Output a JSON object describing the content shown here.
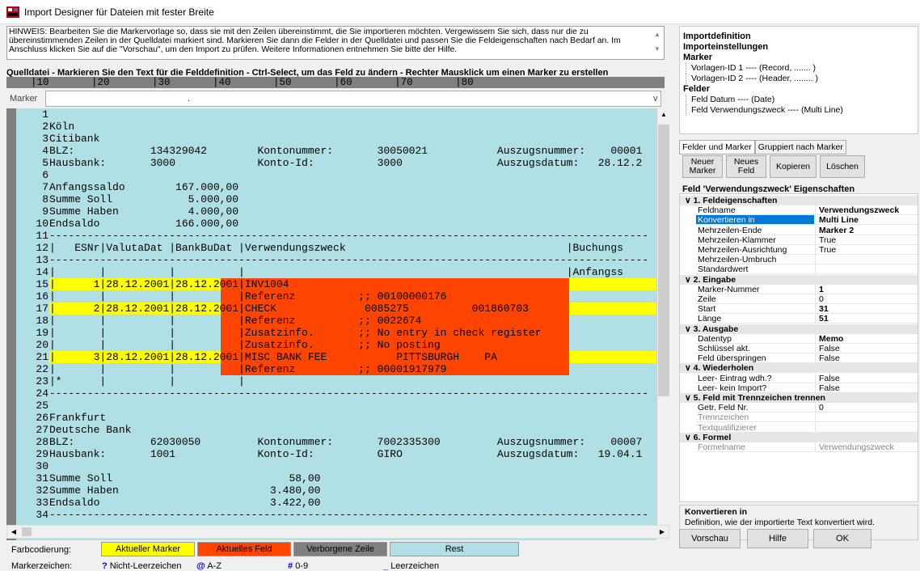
{
  "window": {
    "title": "Import Designer für Dateien mit fester Breite"
  },
  "hint": "HINWEIS: Bearbeiten Sie die Markervorlage so, dass sie mit den Zeilen übereinstimmt, die Sie importieren möchten. Vergewissem Sie sich, dass nur die zu übereinstimmenden Zeilen in der Quelldatei markiert sind. Markieren Sie dann die Felder in der Quelldatei und passen Sie die Feldeigenschaften nach Bedarf an. Im Anschluss klicken Sie auf die \"Vorschau\", um den Import zu prüfen. Weitere Informationen entnehmen Sie bitte der Hilfe.",
  "source_label": "Quelldatei - Markieren Sie den Text für die Felddefinition - Ctrl-Select, um das Feld zu ändern - Rechter Mausklick um einen Marker zu erstellen",
  "ruler": "    |10       |20       |30       |40       |50       |60       |70       |80",
  "marker": {
    "label": "Marker",
    "value": ".",
    "dropdown": "v"
  },
  "lines": [
    {
      "n": "1",
      "t": ""
    },
    {
      "n": "2",
      "t": "Köln"
    },
    {
      "n": "3",
      "t": "Citibank"
    },
    {
      "n": "4",
      "t": "BLZ:            134329042        Kontonummer:       30050021           Auszugsnummer:    00001"
    },
    {
      "n": "5",
      "t": "Hausbank:       3000             Konto-Id:          3000               Auszugsdatum:   28.12.2"
    },
    {
      "n": "6",
      "t": ""
    },
    {
      "n": "7",
      "t": "Anfangssaldo        167.000,00"
    },
    {
      "n": "8",
      "t": "Summe Soll            5.000,00"
    },
    {
      "n": "9",
      "t": "Summe Haben           4.000,00"
    },
    {
      "n": "10",
      "t": "Endsaldo            166.000,00"
    },
    {
      "n": "11",
      "t": "-----------------------------------------------------------------------------------------------"
    },
    {
      "n": "12",
      "t": "|   ESNr|ValutaDat |BankBuDat |Verwendungszweck                                   |Buchungs"
    },
    {
      "n": "13",
      "t": "-----------------------------------------------------------------------------------------------"
    },
    {
      "n": "14",
      "t": "|       |          |          |                                                   |Anfangss"
    },
    {
      "n": "15",
      "t": "|      1|28.12.2001|28.12.2001|INV1004"
    },
    {
      "n": "16",
      "t": "|       |          |          |Referenz          ;; 00100000176"
    },
    {
      "n": "17",
      "t": "|      2|28.12.2001|28.12.2001|CHECK              0085275          001860703"
    },
    {
      "n": "18",
      "t": "|       |          |          |Referenz          ;; 0022674"
    },
    {
      "n": "19",
      "t": "|       |          |          |Zusatzinfo.       ;; No entry in check register"
    },
    {
      "n": "20",
      "t": "|       |          |          |Zusatzinfo.       ;; No posting"
    },
    {
      "n": "21",
      "t": "|      3|28.12.2001|28.12.2001|MISC BANK FEE           PITTSBURGH    PA"
    },
    {
      "n": "22",
      "t": "|       |          |          |Referenz          ;; 00001917979"
    },
    {
      "n": "23",
      "t": "|*      |          |          |"
    },
    {
      "n": "24",
      "t": "-----------------------------------------------------------------------------------------------"
    },
    {
      "n": "25",
      "t": ""
    },
    {
      "n": "26",
      "t": "Frankfurt"
    },
    {
      "n": "27",
      "t": "Deutsche Bank"
    },
    {
      "n": "28",
      "t": "BLZ:            62030050         Kontonummer:       7002335300         Auszugsnummer:    00007"
    },
    {
      "n": "29",
      "t": "Hausbank:       1001             Konto-Id:          GIRO               Auszugsdatum:   19.04.1"
    },
    {
      "n": "30",
      "t": ""
    },
    {
      "n": "31",
      "t": "Summe Soll                            58,00"
    },
    {
      "n": "32",
      "t": "Summe Haben                        3.480,00"
    },
    {
      "n": "33",
      "t": "Endsaldo                           3.422,00"
    },
    {
      "n": "34",
      "t": "-----------------------------------------------------------------------------------------------"
    }
  ],
  "legend": {
    "label": "Farbcodierung:",
    "items": [
      {
        "label": "Aktueller Marker",
        "color": "#ffff00"
      },
      {
        "label": "Aktuelles Feld",
        "color": "#ff4500"
      },
      {
        "label": "Verborgene Zeile",
        "color": "#808080"
      },
      {
        "label": "Rest",
        "color": "#b0dfe5"
      }
    ]
  },
  "marker_chars": {
    "label": "Markerzeichen:",
    "items": [
      {
        "sym": "?",
        "text": "Nicht-Leerzeichen"
      },
      {
        "sym": "@",
        "text": "A-Z"
      },
      {
        "sym": "#",
        "text": "0-9"
      },
      {
        "sym": "_",
        "text": "Leerzeichen"
      }
    ]
  },
  "tree": {
    "h1": "Importdefinition",
    "h2": "Importeinstellungen",
    "marker_h": "Marker",
    "marker_items": [
      "Vorlagen-ID 1 ---- (Record, ....... )",
      "Vorlagen-ID 2 ---- (Header, ........ )"
    ],
    "felder_h": "Felder",
    "felder_items": [
      "Feld Datum ---- (Date)",
      "Feld Verwendungszweck ---- (Multi Line)"
    ]
  },
  "tabs": [
    "Felder und Marker",
    "Gruppiert nach Marker"
  ],
  "buttons": {
    "new_marker": "Neuer Marker",
    "new_field": "Neues Feld",
    "copy": "Kopieren",
    "delete": "Löschen"
  },
  "props_title": "Feld 'Verwendungszweck' Eigenschaften",
  "props": [
    {
      "cat": "1. Feldeigenschaften"
    },
    {
      "k": "Feldname",
      "v": "Verwendungszweck",
      "b": true
    },
    {
      "k": "Konvertieren in",
      "v": "Multi Line",
      "b": true,
      "sel": true
    },
    {
      "k": "Mehrzeilen-Ende",
      "v": "Marker 2",
      "b": true
    },
    {
      "k": "Mehrzeilen-Klammer",
      "v": "True"
    },
    {
      "k": "Mehrzeilen-Ausrichtung",
      "v": "True"
    },
    {
      "k": "Mehrzeilen-Umbruch",
      "v": ""
    },
    {
      "k": "Standardwert",
      "v": ""
    },
    {
      "cat": "2. Eingabe"
    },
    {
      "k": "Marker-Nummer",
      "v": "1",
      "b": true
    },
    {
      "k": "Zeile",
      "v": "0"
    },
    {
      "k": "Start",
      "v": "31",
      "b": true
    },
    {
      "k": "Länge",
      "v": "51",
      "b": true
    },
    {
      "cat": "3. Ausgabe"
    },
    {
      "k": "Datentyp",
      "v": "Memo",
      "b": true
    },
    {
      "k": "Schlüssel akt.",
      "v": "False"
    },
    {
      "k": "Feld überspringen",
      "v": "False"
    },
    {
      "cat": "4. Wiederholen"
    },
    {
      "k": "Leer- Eintrag wdh.?",
      "v": "False"
    },
    {
      "k": "Leer- kein Import?",
      "v": "False"
    },
    {
      "cat": "5. Feld mit Trennzeichen trennen"
    },
    {
      "k": "Getr. Feld Nr.",
      "v": "0"
    },
    {
      "k": "Trennzeichen",
      "v": "",
      "g": true
    },
    {
      "k": "Textqualifizierer",
      "v": "",
      "g": true
    },
    {
      "cat": "6. Formel"
    },
    {
      "k": "Formelname",
      "v": "Verwendungszweck",
      "g": true
    }
  ],
  "desc": {
    "title": "Konvertieren in",
    "text": "Definition, wie der importierte Text konvertiert wird."
  },
  "bottom_buttons": {
    "preview": "Vorschau",
    "help": "Hilfe",
    "ok": "OK"
  }
}
